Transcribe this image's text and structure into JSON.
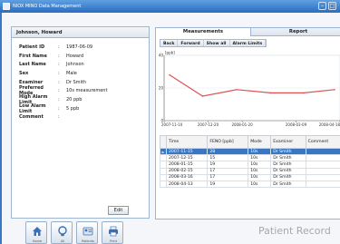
{
  "window": {
    "title": "NIOX MINO Data Management"
  },
  "patient_panel": {
    "header": "Johnson, Howard",
    "fields": [
      {
        "label": "Patient ID",
        "value": "1987-06-09"
      },
      {
        "label": "First Name",
        "value": "Howard"
      },
      {
        "label": "Last Name",
        "value": "Johnson"
      },
      {
        "label": "Sex",
        "value": "Male"
      },
      {
        "label": "Examiner",
        "value": "Dr Smith"
      },
      {
        "label": "Preferred Mode",
        "value": "10s measurement"
      },
      {
        "label": "High Alarm Limit",
        "value": "20 ppb"
      },
      {
        "label": "Low Alarm Limit",
        "value": "5 ppb"
      },
      {
        "label": "Comment",
        "value": ""
      }
    ],
    "separator": ":",
    "edit_label": "Edit"
  },
  "tabs": [
    {
      "label": "Measurements",
      "active": true
    },
    {
      "label": "Report",
      "active": false
    }
  ],
  "toolbar": {
    "back": "Back",
    "forward": "Forward",
    "show_all": "Show all",
    "alarm_limits": "Alarm Limits"
  },
  "chart_data": {
    "type": "line",
    "ylabel": "[ppb]",
    "ylim": [
      0,
      40
    ],
    "yticks": [
      "40",
      "20",
      "0"
    ],
    "xticks": [
      "2007-11-10",
      "2007-12-20",
      "2008-01-20",
      "2008-03-09",
      "2008-04-18"
    ],
    "x": [
      "2007-11-15",
      "2007-12-15",
      "2008-01-15",
      "2008-02-15",
      "2008-03-16",
      "2008-04-13"
    ],
    "values": [
      28,
      15,
      19,
      17,
      17,
      19
    ],
    "line_color": "#e05050"
  },
  "table": {
    "columns": [
      "Time",
      "FENO [ppb]",
      "Mode",
      "Examiner",
      "Comment"
    ],
    "rows": [
      {
        "time": "2007-11-15",
        "feno": "28",
        "mode": "10s",
        "examiner": "Dr Smith",
        "comment": "",
        "selected": true
      },
      {
        "time": "2007-12-15",
        "feno": "15",
        "mode": "10s",
        "examiner": "Dr Smith",
        "comment": "",
        "selected": false
      },
      {
        "time": "2008-01-15",
        "feno": "19",
        "mode": "10s",
        "examiner": "Dr Smith",
        "comment": "",
        "selected": false
      },
      {
        "time": "2008-02-15",
        "feno": "17",
        "mode": "10s",
        "examiner": "Dr Smith",
        "comment": "",
        "selected": false
      },
      {
        "time": "2008-03-16",
        "feno": "17",
        "mode": "10s",
        "examiner": "Dr Smith",
        "comment": "",
        "selected": false
      },
      {
        "time": "2008-04-13",
        "feno": "19",
        "mode": "10s",
        "examiner": "Dr Smith",
        "comment": "",
        "selected": false
      }
    ],
    "selected_marker": "►"
  },
  "bottom_buttons": [
    {
      "icon": "home-icon",
      "label": "Home"
    },
    {
      "icon": "bulb-icon",
      "label": "All"
    },
    {
      "icon": "patients-icon",
      "label": "Patients"
    },
    {
      "icon": "print-icon",
      "label": "Print"
    }
  ],
  "watermark": "Patient Record"
}
